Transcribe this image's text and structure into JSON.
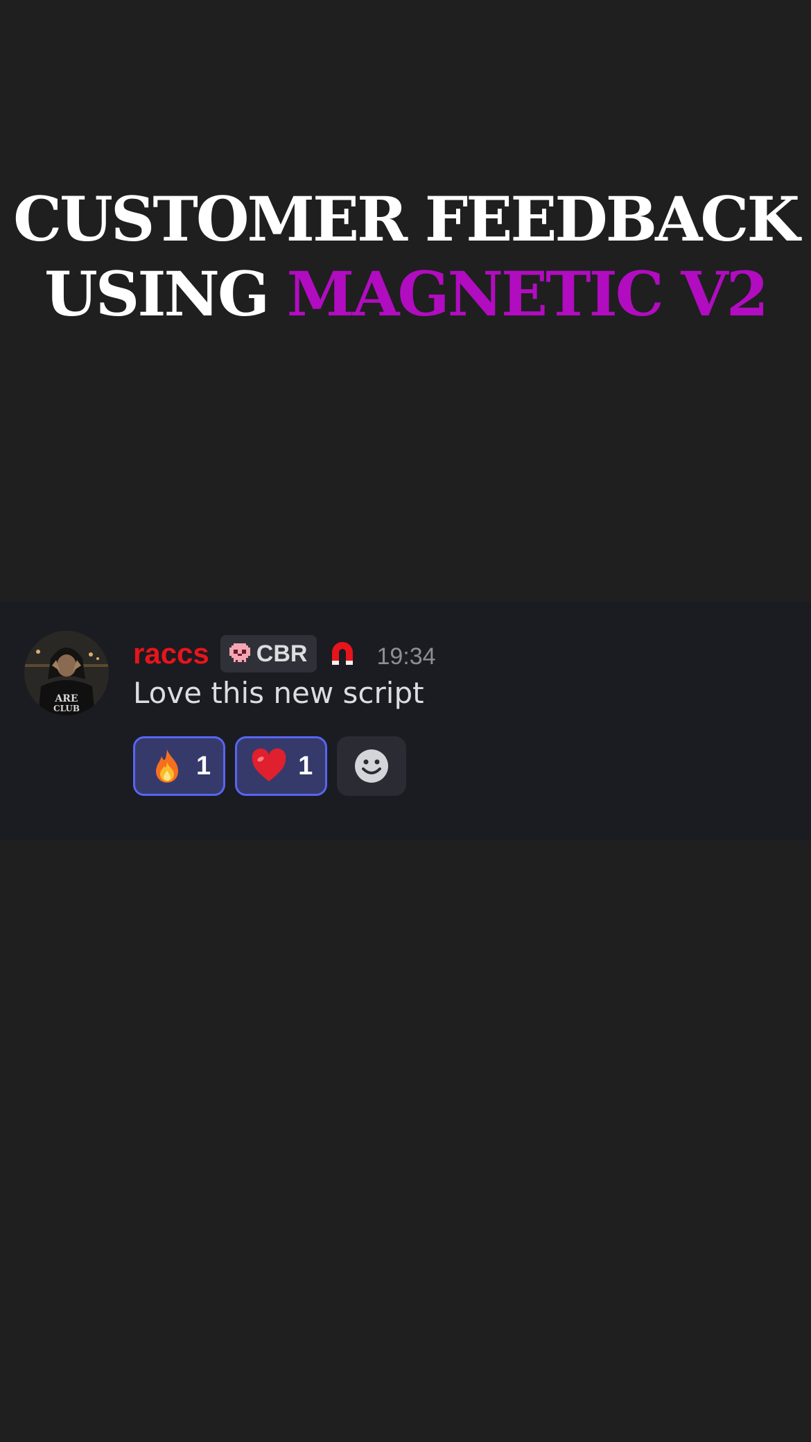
{
  "headline": {
    "line1": "CUSTOMER FEEDBACK",
    "line2_prefix": "USING ",
    "line2_accent": "MAGNETIC V2",
    "accent_color": "#b10cc0"
  },
  "message": {
    "username": "raccs",
    "username_color": "#e8141c",
    "tag_icon": "skull-icon",
    "tag_label": "CBR",
    "role_icon": "magnet-icon",
    "timestamp": "19:34",
    "text": "Love this new script",
    "reactions": [
      {
        "icon": "fire-emoji",
        "count": "1"
      },
      {
        "icon": "heart-emoji",
        "count": "1"
      }
    ],
    "add_reaction_icon": "smiley-icon"
  }
}
